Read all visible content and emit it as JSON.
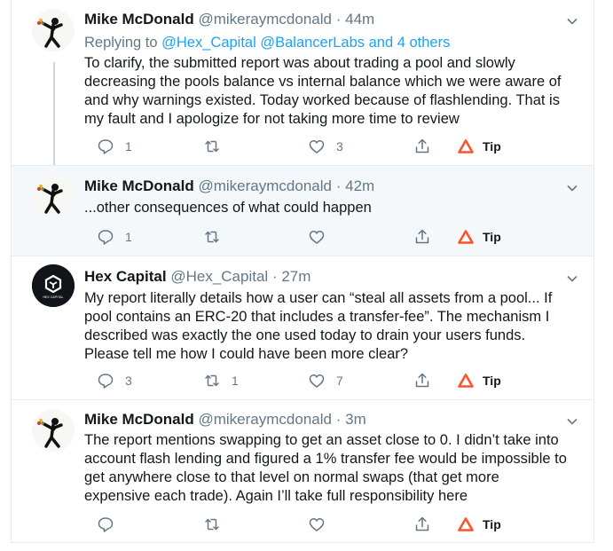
{
  "icons": {
    "reply": "reply-icon",
    "retweet": "retweet-icon",
    "like": "like-icon",
    "share": "share-icon",
    "tip": "brave-tip-icon",
    "menu": "chevron-down-icon"
  },
  "colors": {
    "link": "#1da1f2",
    "muted": "#657786",
    "highlight_bg": "#f5f8fa",
    "tip_triangle": "#fb542b"
  },
  "tweets": [
    {
      "name": "Mike McDonald",
      "handle": "@mikeraymcdonald",
      "dot": "·",
      "time": "44m",
      "replying_prefix": "Replying to ",
      "replying_mentions": "@Hex_Capital @BalancerLabs and 4 others",
      "lines": [
        "To clarify, the submitted report was about trading a pool and slowly",
        "decreasing the pools balance vs internal balance which we were aware of",
        "and why warnings existed. Today worked because of flashlending. That is",
        "my fault and I apologize for not taking more time to review"
      ],
      "reply_count": "1",
      "retweet_count": "",
      "like_count": "3",
      "tip_label": "Tip"
    },
    {
      "name": "Mike McDonald",
      "handle": "@mikeraymcdonald",
      "dot": "·",
      "time": "42m",
      "lines": [
        "...other consequences of what could happen"
      ],
      "reply_count": "1",
      "retweet_count": "",
      "like_count": "",
      "tip_label": "Tip"
    },
    {
      "name": "Hex Capital",
      "handle": "@Hex_Capital",
      "dot": "·",
      "time": "27m",
      "avatar_text": "HEX CAPITAL",
      "lines": [
        "My report literally details how a user can “steal all assets from a pool... If",
        "pool contains an ERC-20 that includes a transfer-fee”. The mechanism I",
        "described was exactly the one used today to drain your users funds.",
        "Please tell me how I could have been more clear?"
      ],
      "reply_count": "3",
      "retweet_count": "1",
      "like_count": "7",
      "tip_label": "Tip"
    },
    {
      "name": "Mike McDonald",
      "handle": "@mikeraymcdonald",
      "dot": "·",
      "time": "3m",
      "lines": [
        "The report mentions swapping to get an asset close to 0. I didn’t take into",
        "account flash lending and figured a 1% transfer fee would be impossible to",
        "get anywhere close to that level on normal swaps (that get more",
        "expensive each trade). Again I’ll take full responsibility here"
      ],
      "reply_count": "",
      "retweet_count": "",
      "like_count": "",
      "tip_label": "Tip"
    }
  ]
}
